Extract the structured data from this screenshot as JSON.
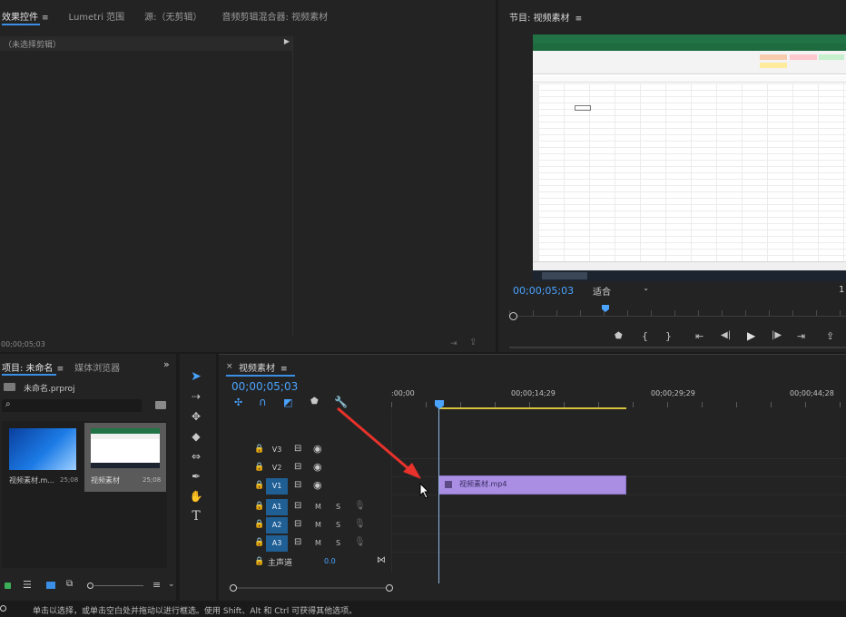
{
  "effects_panel": {
    "tabs": [
      {
        "label": "效果控件",
        "active": true
      },
      {
        "label": "Lumetri 范围",
        "active": false
      },
      {
        "label": "源:（无剪辑）",
        "active": false
      },
      {
        "label": "音频剪辑混合器: 视频素材",
        "active": false
      }
    ],
    "no_clip_label": "（未选择剪辑）",
    "timecode": "00;00;05;03"
  },
  "program_monitor": {
    "title": "节目: 视频素材",
    "timecode": "00;00;05;03",
    "fit_label": "适合",
    "quality_label": "1"
  },
  "project_panel": {
    "tabs": [
      {
        "label": "项目: 未命名",
        "active": true
      },
      {
        "label": "媒体浏览器",
        "active": false
      }
    ],
    "project_file": "未命名.prproj",
    "search_placeholder": "",
    "items": [
      {
        "name": "视频素材.m...",
        "duration": "25;08",
        "thumb": "desktop",
        "selected": false
      },
      {
        "name": "视频素材",
        "duration": "25;08",
        "thumb": "excel",
        "selected": true
      }
    ]
  },
  "timeline": {
    "title": "视频素材",
    "timecode": "00;00;05;03",
    "ruler_labels": [
      ":00;00",
      "00;00;14;29",
      "00;00;29;29",
      "00;00;44;28"
    ],
    "video_tracks": [
      "V3",
      "V2",
      "V1"
    ],
    "audio_tracks": [
      "A1",
      "A2",
      "A3"
    ],
    "clip_label": "视频素材.mp4",
    "master_label": "主声道",
    "master_value": "0.0",
    "mute_label": "M",
    "solo_label": "S"
  },
  "status_bar": {
    "text": "单击以选择，或单击空白处并拖动以进行框选。使用 Shift、Alt 和 Ctrl 可获得其他选项。"
  },
  "colors": {
    "accent_blue": "#4aa3ff",
    "clip_purple": "#a98ee3",
    "track_on": "#1f5f94",
    "excel_green": "#217346",
    "annotation_red": "#e8322b"
  }
}
